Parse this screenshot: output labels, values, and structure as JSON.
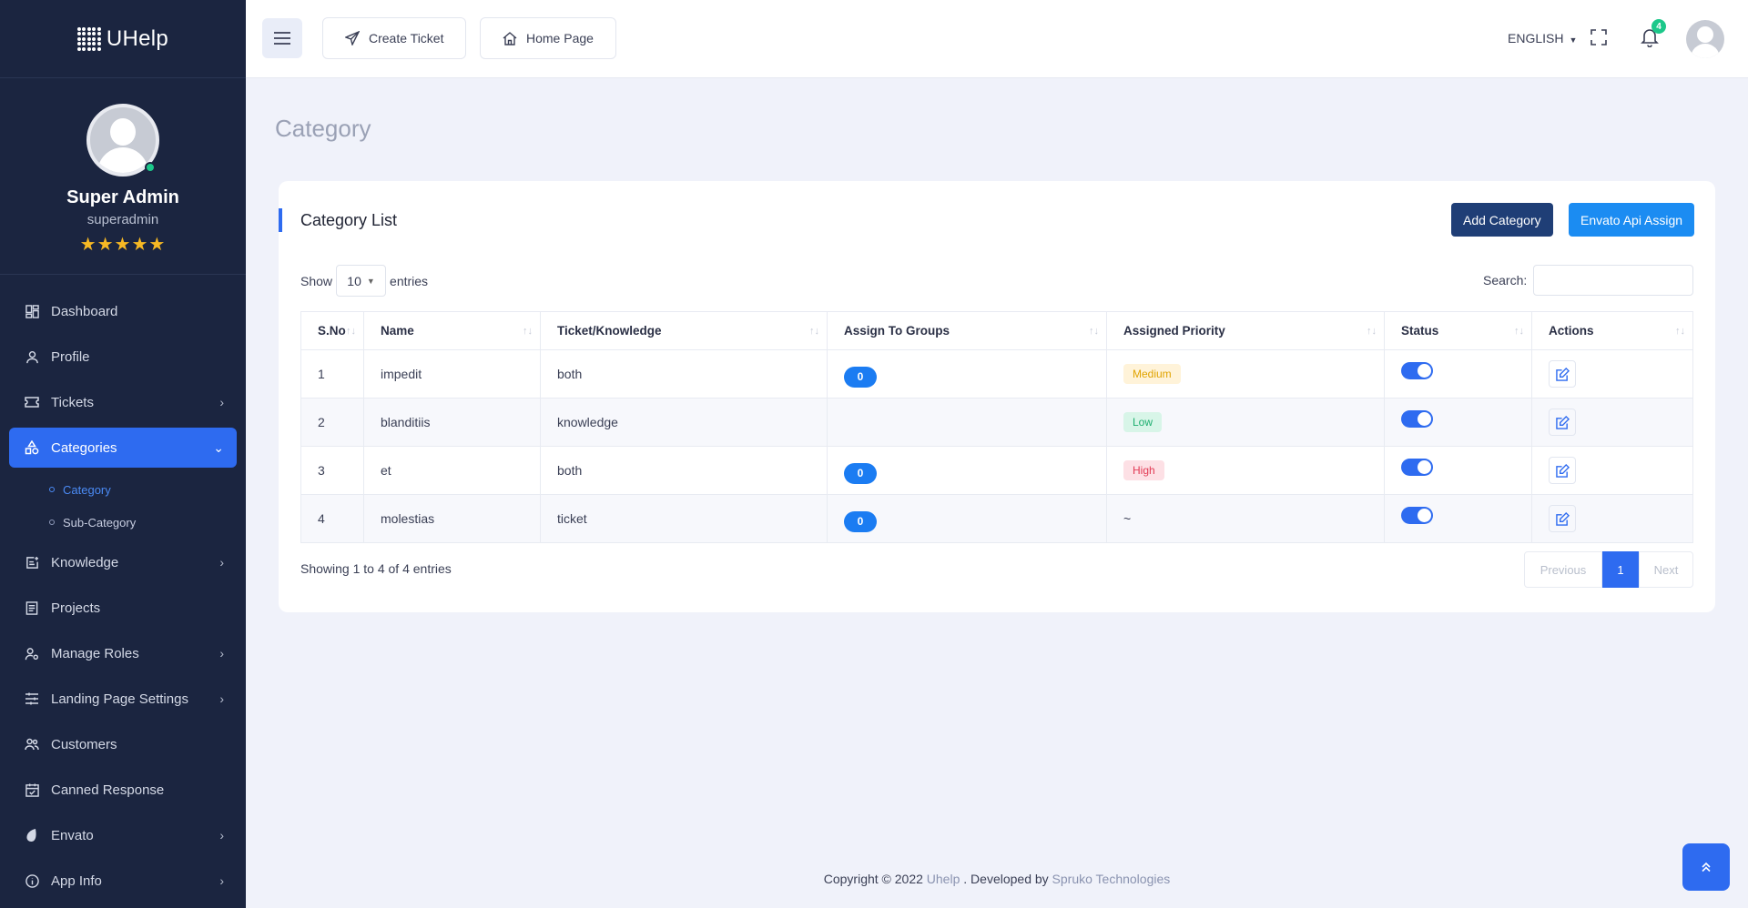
{
  "brand": {
    "name": "UHelp"
  },
  "user": {
    "name": "Super Admin",
    "username": "superadmin",
    "stars": "★★★★★"
  },
  "sidebar": {
    "items": [
      {
        "label": "Dashboard",
        "icon": "dashboard-icon"
      },
      {
        "label": "Profile",
        "icon": "user-icon"
      },
      {
        "label": "Tickets",
        "icon": "ticket-icon"
      },
      {
        "label": "Categories",
        "icon": "categories-icon"
      },
      {
        "label": "Knowledge",
        "icon": "knowledge-icon"
      },
      {
        "label": "Projects",
        "icon": "projects-icon"
      },
      {
        "label": "Manage Roles",
        "icon": "roles-icon"
      },
      {
        "label": "Landing Page Settings",
        "icon": "sliders-icon"
      },
      {
        "label": "Customers",
        "icon": "customers-icon"
      },
      {
        "label": "Canned Response",
        "icon": "canned-icon"
      },
      {
        "label": "Envato",
        "icon": "envato-icon"
      },
      {
        "label": "App Info",
        "icon": "info-icon"
      }
    ],
    "sub_items": [
      {
        "label": "Category"
      },
      {
        "label": "Sub-Category"
      }
    ]
  },
  "header": {
    "create_ticket": "Create Ticket",
    "home_page": "Home Page",
    "language": "ENGLISH",
    "notification_count": "4"
  },
  "page": {
    "title": "Category"
  },
  "card": {
    "title": "Category List",
    "add_button": "Add Category",
    "envato_button": "Envato Api Assign",
    "show_label": "Show",
    "entries_value": "10",
    "entries_label": "entries",
    "search_label": "Search:",
    "columns": [
      "S.No",
      "Name",
      "Ticket/Knowledge",
      "Assign To Groups",
      "Assigned Priority",
      "Status",
      "Actions"
    ],
    "rows": [
      {
        "sno": "1",
        "name": "impedit",
        "type": "both",
        "groups": "0",
        "priority": "Medium",
        "priority_level": "medium"
      },
      {
        "sno": "2",
        "name": "blanditiis",
        "type": "knowledge",
        "groups": "",
        "priority": "Low",
        "priority_level": "low"
      },
      {
        "sno": "3",
        "name": "et",
        "type": "both",
        "groups": "0",
        "priority": "High",
        "priority_level": "high"
      },
      {
        "sno": "4",
        "name": "molestias",
        "type": "ticket",
        "groups": "0",
        "priority": "~",
        "priority_level": "none"
      }
    ],
    "info": "Showing 1 to 4 of 4 entries",
    "pager": {
      "previous": "Previous",
      "current": "1",
      "next": "Next"
    }
  },
  "footer": {
    "prefix": "Copyright © 2022 ",
    "brand_link": "Uhelp",
    "middle": " . Developed by ",
    "dev_link": "Spruko Technologies"
  },
  "colors": {
    "primary": "#2e6bf0",
    "sidebar": "#1b2540",
    "dark_button": "#1f3e76",
    "info_button": "#1b8cf2"
  }
}
